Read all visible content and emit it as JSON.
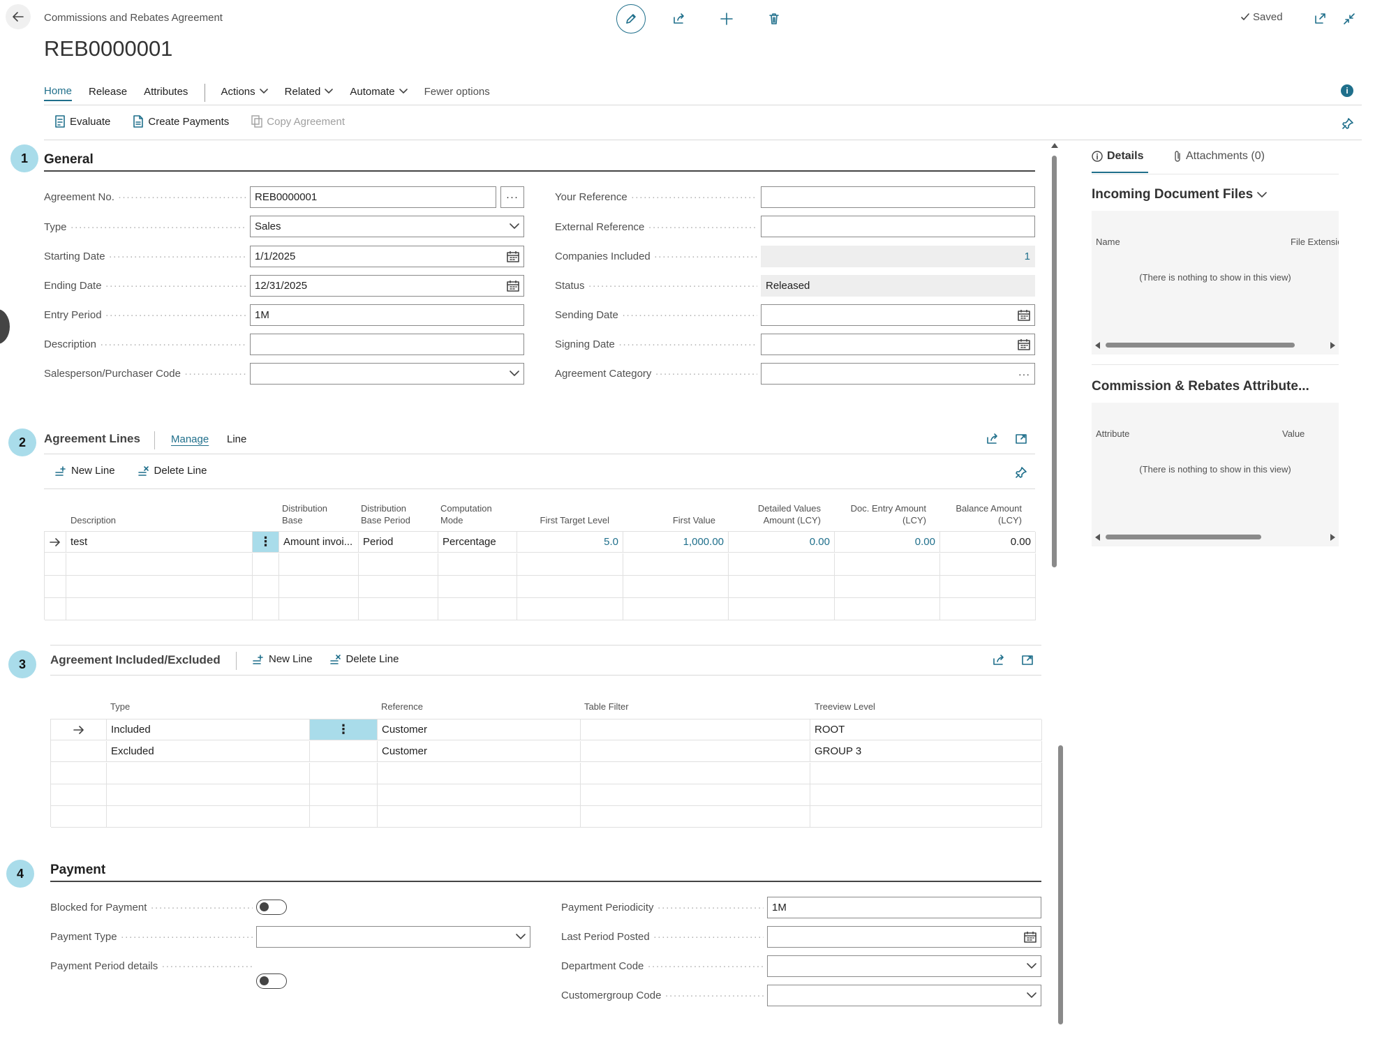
{
  "header": {
    "breadcrumb": "Commissions and Rebates Agreement",
    "title": "REB0000001",
    "saved": "Saved"
  },
  "action_tabs": [
    "Home",
    "Release",
    "Attributes",
    "Actions",
    "Related",
    "Automate",
    "Fewer options"
  ],
  "actions": {
    "evaluate": "Evaluate",
    "create_payments": "Create Payments",
    "copy_agreement": "Copy Agreement"
  },
  "general": {
    "number": "1",
    "title": "General",
    "left_fields": [
      {
        "label": "Agreement No.",
        "value": "REB0000001",
        "type": "ellipsis"
      },
      {
        "label": "Type",
        "value": "Sales",
        "type": "select"
      },
      {
        "label": "Starting Date",
        "value": "1/1/2025",
        "type": "date"
      },
      {
        "label": "Ending Date",
        "value": "12/31/2025",
        "type": "date"
      },
      {
        "label": "Entry Period",
        "value": "1M",
        "type": "text"
      },
      {
        "label": "Description",
        "value": "",
        "type": "text"
      },
      {
        "label": "Salesperson/Purchaser Code",
        "value": "",
        "type": "select"
      }
    ],
    "right_fields": [
      {
        "label": "Your Reference",
        "value": "",
        "type": "text"
      },
      {
        "label": "External Reference",
        "value": "",
        "type": "text"
      },
      {
        "label": "Companies Included",
        "value": "1",
        "type": "readonly-number"
      },
      {
        "label": "Status",
        "value": "Released",
        "type": "readonly"
      },
      {
        "label": "Sending Date",
        "value": "",
        "type": "date"
      },
      {
        "label": "Signing Date",
        "value": "",
        "type": "date"
      },
      {
        "label": "Agreement Category",
        "value": "",
        "type": "ellipsis-inline"
      }
    ]
  },
  "agreement_lines": {
    "number": "2",
    "title": "Agreement Lines",
    "tabs": [
      "Manage",
      "Line"
    ],
    "new_line": "New Line",
    "delete_line": "Delete Line",
    "columns": [
      [
        "Description",
        ""
      ],
      [
        "Distribution",
        "Base"
      ],
      [
        "Distribution",
        "Base Period"
      ],
      [
        "Computation",
        "Mode"
      ],
      [
        "First Target Level",
        ""
      ],
      [
        "First Value",
        ""
      ],
      [
        "Detailed Values",
        "Amount (LCY)"
      ],
      [
        "Doc. Entry Amount",
        "(LCY)"
      ],
      [
        "Balance Amount",
        "(LCY)"
      ]
    ],
    "rows": [
      {
        "description": "test",
        "distribution_base": "Amount invoi...",
        "distribution_base_period": "Period",
        "computation_mode": "Percentage",
        "first_target_level": "5.0",
        "first_value": "1,000.00",
        "detailed_values_amount": "0.00",
        "doc_entry_amount": "0.00",
        "balance_amount": "0.00"
      }
    ]
  },
  "included_excluded": {
    "number": "3",
    "title": "Agreement Included/Excluded",
    "new_line": "New Line",
    "delete_line": "Delete Line",
    "columns": [
      "Type",
      "Reference",
      "Table Filter",
      "Treeview Level"
    ],
    "rows": [
      {
        "type": "Included",
        "reference": "Customer",
        "table_filter": "",
        "treeview_level": "ROOT"
      },
      {
        "type": "Excluded",
        "reference": "Customer",
        "table_filter": "",
        "treeview_level": "GROUP 3"
      }
    ]
  },
  "payment": {
    "number": "4",
    "title": "Payment",
    "left_fields": [
      {
        "label": "Blocked for Payment",
        "type": "toggle"
      },
      {
        "label": "Payment Type",
        "value": "",
        "type": "select"
      },
      {
        "label": "Payment Period details",
        "type": "toggle"
      }
    ],
    "right_fields": [
      {
        "label": "Payment Periodicity",
        "value": "1M",
        "type": "text"
      },
      {
        "label": "Last Period Posted",
        "value": "",
        "type": "date"
      },
      {
        "label": "Department Code",
        "value": "",
        "type": "select"
      },
      {
        "label": "Customergroup Code",
        "value": "",
        "type": "select"
      }
    ]
  },
  "factbox": {
    "tabs": [
      "Details",
      "Attachments (0)"
    ],
    "incoming_title": "Incoming Document Files",
    "incoming_columns": [
      "Name",
      "File Extensio"
    ],
    "empty_message": "(There is nothing to show in this view)",
    "attributes_title": "Commission & Rebates Attribute...",
    "attributes_columns": [
      "Attribute",
      "Value"
    ]
  },
  "colors": {
    "accent": "#1f6f8b",
    "step_circle": "#a9dcea",
    "readonly_bg": "#eeeeee"
  }
}
